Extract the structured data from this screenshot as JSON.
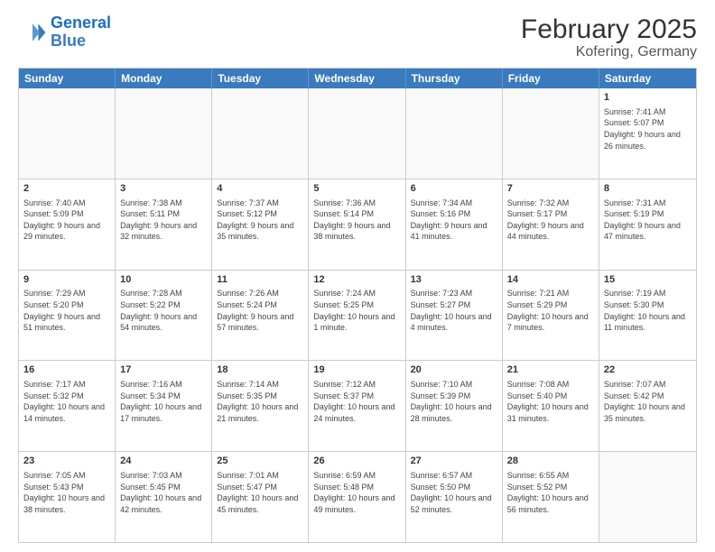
{
  "header": {
    "logo_line1": "General",
    "logo_line2": "Blue",
    "title": "February 2025",
    "subtitle": "Kofering, Germany"
  },
  "weekdays": [
    "Sunday",
    "Monday",
    "Tuesday",
    "Wednesday",
    "Thursday",
    "Friday",
    "Saturday"
  ],
  "weeks": [
    [
      {
        "day": "",
        "info": ""
      },
      {
        "day": "",
        "info": ""
      },
      {
        "day": "",
        "info": ""
      },
      {
        "day": "",
        "info": ""
      },
      {
        "day": "",
        "info": ""
      },
      {
        "day": "",
        "info": ""
      },
      {
        "day": "1",
        "info": "Sunrise: 7:41 AM\nSunset: 5:07 PM\nDaylight: 9 hours and 26 minutes."
      }
    ],
    [
      {
        "day": "2",
        "info": "Sunrise: 7:40 AM\nSunset: 5:09 PM\nDaylight: 9 hours and 29 minutes."
      },
      {
        "day": "3",
        "info": "Sunrise: 7:38 AM\nSunset: 5:11 PM\nDaylight: 9 hours and 32 minutes."
      },
      {
        "day": "4",
        "info": "Sunrise: 7:37 AM\nSunset: 5:12 PM\nDaylight: 9 hours and 35 minutes."
      },
      {
        "day": "5",
        "info": "Sunrise: 7:36 AM\nSunset: 5:14 PM\nDaylight: 9 hours and 38 minutes."
      },
      {
        "day": "6",
        "info": "Sunrise: 7:34 AM\nSunset: 5:16 PM\nDaylight: 9 hours and 41 minutes."
      },
      {
        "day": "7",
        "info": "Sunrise: 7:32 AM\nSunset: 5:17 PM\nDaylight: 9 hours and 44 minutes."
      },
      {
        "day": "8",
        "info": "Sunrise: 7:31 AM\nSunset: 5:19 PM\nDaylight: 9 hours and 47 minutes."
      }
    ],
    [
      {
        "day": "9",
        "info": "Sunrise: 7:29 AM\nSunset: 5:20 PM\nDaylight: 9 hours and 51 minutes."
      },
      {
        "day": "10",
        "info": "Sunrise: 7:28 AM\nSunset: 5:22 PM\nDaylight: 9 hours and 54 minutes."
      },
      {
        "day": "11",
        "info": "Sunrise: 7:26 AM\nSunset: 5:24 PM\nDaylight: 9 hours and 57 minutes."
      },
      {
        "day": "12",
        "info": "Sunrise: 7:24 AM\nSunset: 5:25 PM\nDaylight: 10 hours and 1 minute."
      },
      {
        "day": "13",
        "info": "Sunrise: 7:23 AM\nSunset: 5:27 PM\nDaylight: 10 hours and 4 minutes."
      },
      {
        "day": "14",
        "info": "Sunrise: 7:21 AM\nSunset: 5:29 PM\nDaylight: 10 hours and 7 minutes."
      },
      {
        "day": "15",
        "info": "Sunrise: 7:19 AM\nSunset: 5:30 PM\nDaylight: 10 hours and 11 minutes."
      }
    ],
    [
      {
        "day": "16",
        "info": "Sunrise: 7:17 AM\nSunset: 5:32 PM\nDaylight: 10 hours and 14 minutes."
      },
      {
        "day": "17",
        "info": "Sunrise: 7:16 AM\nSunset: 5:34 PM\nDaylight: 10 hours and 17 minutes."
      },
      {
        "day": "18",
        "info": "Sunrise: 7:14 AM\nSunset: 5:35 PM\nDaylight: 10 hours and 21 minutes."
      },
      {
        "day": "19",
        "info": "Sunrise: 7:12 AM\nSunset: 5:37 PM\nDaylight: 10 hours and 24 minutes."
      },
      {
        "day": "20",
        "info": "Sunrise: 7:10 AM\nSunset: 5:39 PM\nDaylight: 10 hours and 28 minutes."
      },
      {
        "day": "21",
        "info": "Sunrise: 7:08 AM\nSunset: 5:40 PM\nDaylight: 10 hours and 31 minutes."
      },
      {
        "day": "22",
        "info": "Sunrise: 7:07 AM\nSunset: 5:42 PM\nDaylight: 10 hours and 35 minutes."
      }
    ],
    [
      {
        "day": "23",
        "info": "Sunrise: 7:05 AM\nSunset: 5:43 PM\nDaylight: 10 hours and 38 minutes."
      },
      {
        "day": "24",
        "info": "Sunrise: 7:03 AM\nSunset: 5:45 PM\nDaylight: 10 hours and 42 minutes."
      },
      {
        "day": "25",
        "info": "Sunrise: 7:01 AM\nSunset: 5:47 PM\nDaylight: 10 hours and 45 minutes."
      },
      {
        "day": "26",
        "info": "Sunrise: 6:59 AM\nSunset: 5:48 PM\nDaylight: 10 hours and 49 minutes."
      },
      {
        "day": "27",
        "info": "Sunrise: 6:57 AM\nSunset: 5:50 PM\nDaylight: 10 hours and 52 minutes."
      },
      {
        "day": "28",
        "info": "Sunrise: 6:55 AM\nSunset: 5:52 PM\nDaylight: 10 hours and 56 minutes."
      },
      {
        "day": "",
        "info": ""
      }
    ]
  ]
}
